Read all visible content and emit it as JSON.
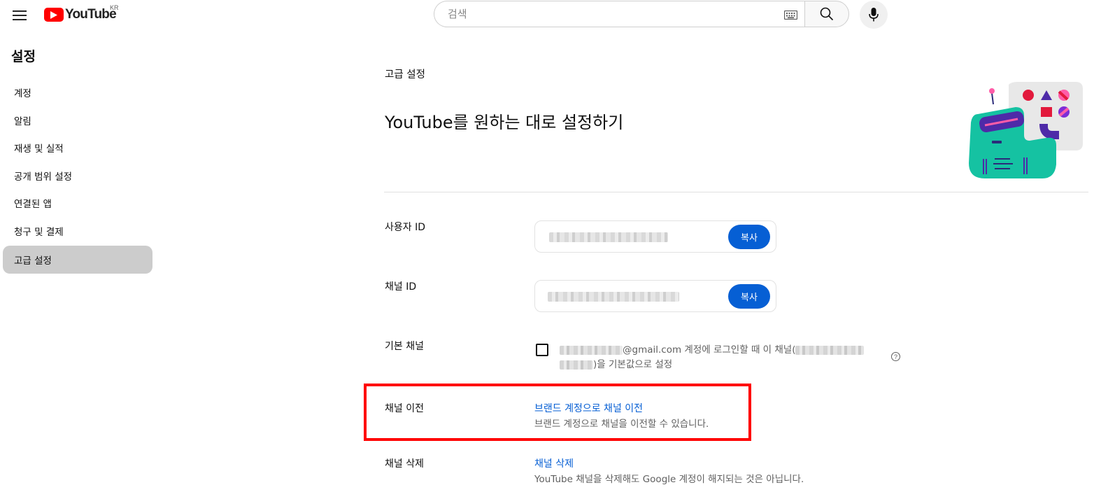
{
  "header": {
    "logo_text": "YouTube",
    "country_code": "KR",
    "search_placeholder": "검색"
  },
  "sidebar": {
    "title": "설정",
    "items": [
      {
        "label": "계정"
      },
      {
        "label": "알림"
      },
      {
        "label": "재생 및 실적"
      },
      {
        "label": "공개 범위 설정"
      },
      {
        "label": "연결된 앱"
      },
      {
        "label": "청구 및 결제"
      },
      {
        "label": "고급 설정",
        "active": true
      }
    ]
  },
  "main": {
    "section_label": "고급 설정",
    "title": "YouTube를 원하는 대로 설정하기",
    "user_id": {
      "label": "사용자 ID",
      "copy_label": "복사"
    },
    "channel_id": {
      "label": "채널 ID",
      "copy_label": "복사"
    },
    "default_channel": {
      "label": "기본 채널",
      "text_part1": "@gmail.com",
      "text_part2": " 계정에 로그인할 때 이 채널(",
      "text_part3": ")을 기본값으로 설정",
      "help_glyph": "?"
    },
    "channel_move": {
      "label": "채널 이전",
      "link": "브랜드 계정으로 채널 이전",
      "desc": "브랜드 계정으로 채널을 이전할 수 있습니다."
    },
    "channel_delete": {
      "label": "채널 삭제",
      "link": "채널 삭제",
      "desc": "YouTube 채널을 삭제해도 Google 계정이 해지되는 것은 아닙니다."
    }
  },
  "colors": {
    "brand_red": "#ff0000",
    "link_blue": "#065fd4",
    "highlight_red": "#ff0000",
    "active_nav": "#cccccc"
  }
}
